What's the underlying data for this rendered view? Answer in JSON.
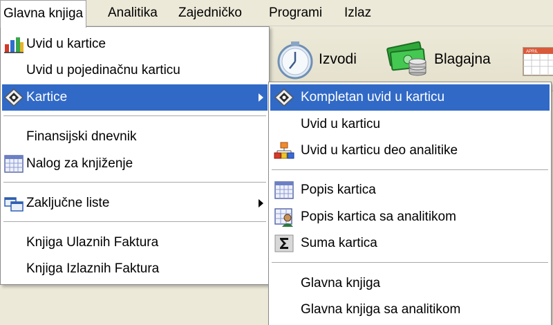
{
  "menubar": {
    "items": [
      {
        "label": "Glavna knjiga"
      },
      {
        "label": "Analitika"
      },
      {
        "label": "Zajedničko"
      },
      {
        "label": "Programi"
      },
      {
        "label": "Izlaz"
      }
    ]
  },
  "toolbar": {
    "izvodi_label": "Izvodi",
    "blagajna_label": "Blagajna",
    "calendar_caption": "APRIL"
  },
  "glavna_menu": {
    "items": [
      {
        "label": "Uvid u kartice",
        "icon": "bar-chart-icon"
      },
      {
        "label": "Uvid u pojedinačnu karticu"
      },
      {
        "label": "Kartice",
        "icon": "diamond-card-icon",
        "submenu": true,
        "highlighted": true
      },
      {
        "label": "Finansijski dnevnik"
      },
      {
        "label": "Nalog za knjiženje",
        "icon": "calendar-grid-icon"
      },
      {
        "label": "Zaključne liste",
        "icon": "windows-stack-icon",
        "submenu": true
      },
      {
        "label": "Knjiga Ulaznih Faktura"
      },
      {
        "label": "Knjiga Izlaznih Faktura"
      }
    ]
  },
  "kartice_submenu": {
    "items": [
      {
        "label": "Kompletan uvid u karticu",
        "icon": "diamond-card-icon",
        "highlighted": true
      },
      {
        "label": "Uvid u karticu"
      },
      {
        "label": "Uvid u karticu deo analitike",
        "icon": "org-chart-icon"
      },
      {
        "label": "Popis kartica",
        "icon": "calendar-grid-icon"
      },
      {
        "label": "Popis kartica sa analitikom",
        "icon": "person-grid-icon"
      },
      {
        "label": "Suma kartica",
        "icon": "sigma-icon"
      },
      {
        "label": "Glavna knjiga"
      },
      {
        "label": "Glavna knjiga sa analitikom"
      }
    ]
  },
  "colors": {
    "highlight": "#3169c6",
    "menubar_bg": "#ece9d8"
  }
}
